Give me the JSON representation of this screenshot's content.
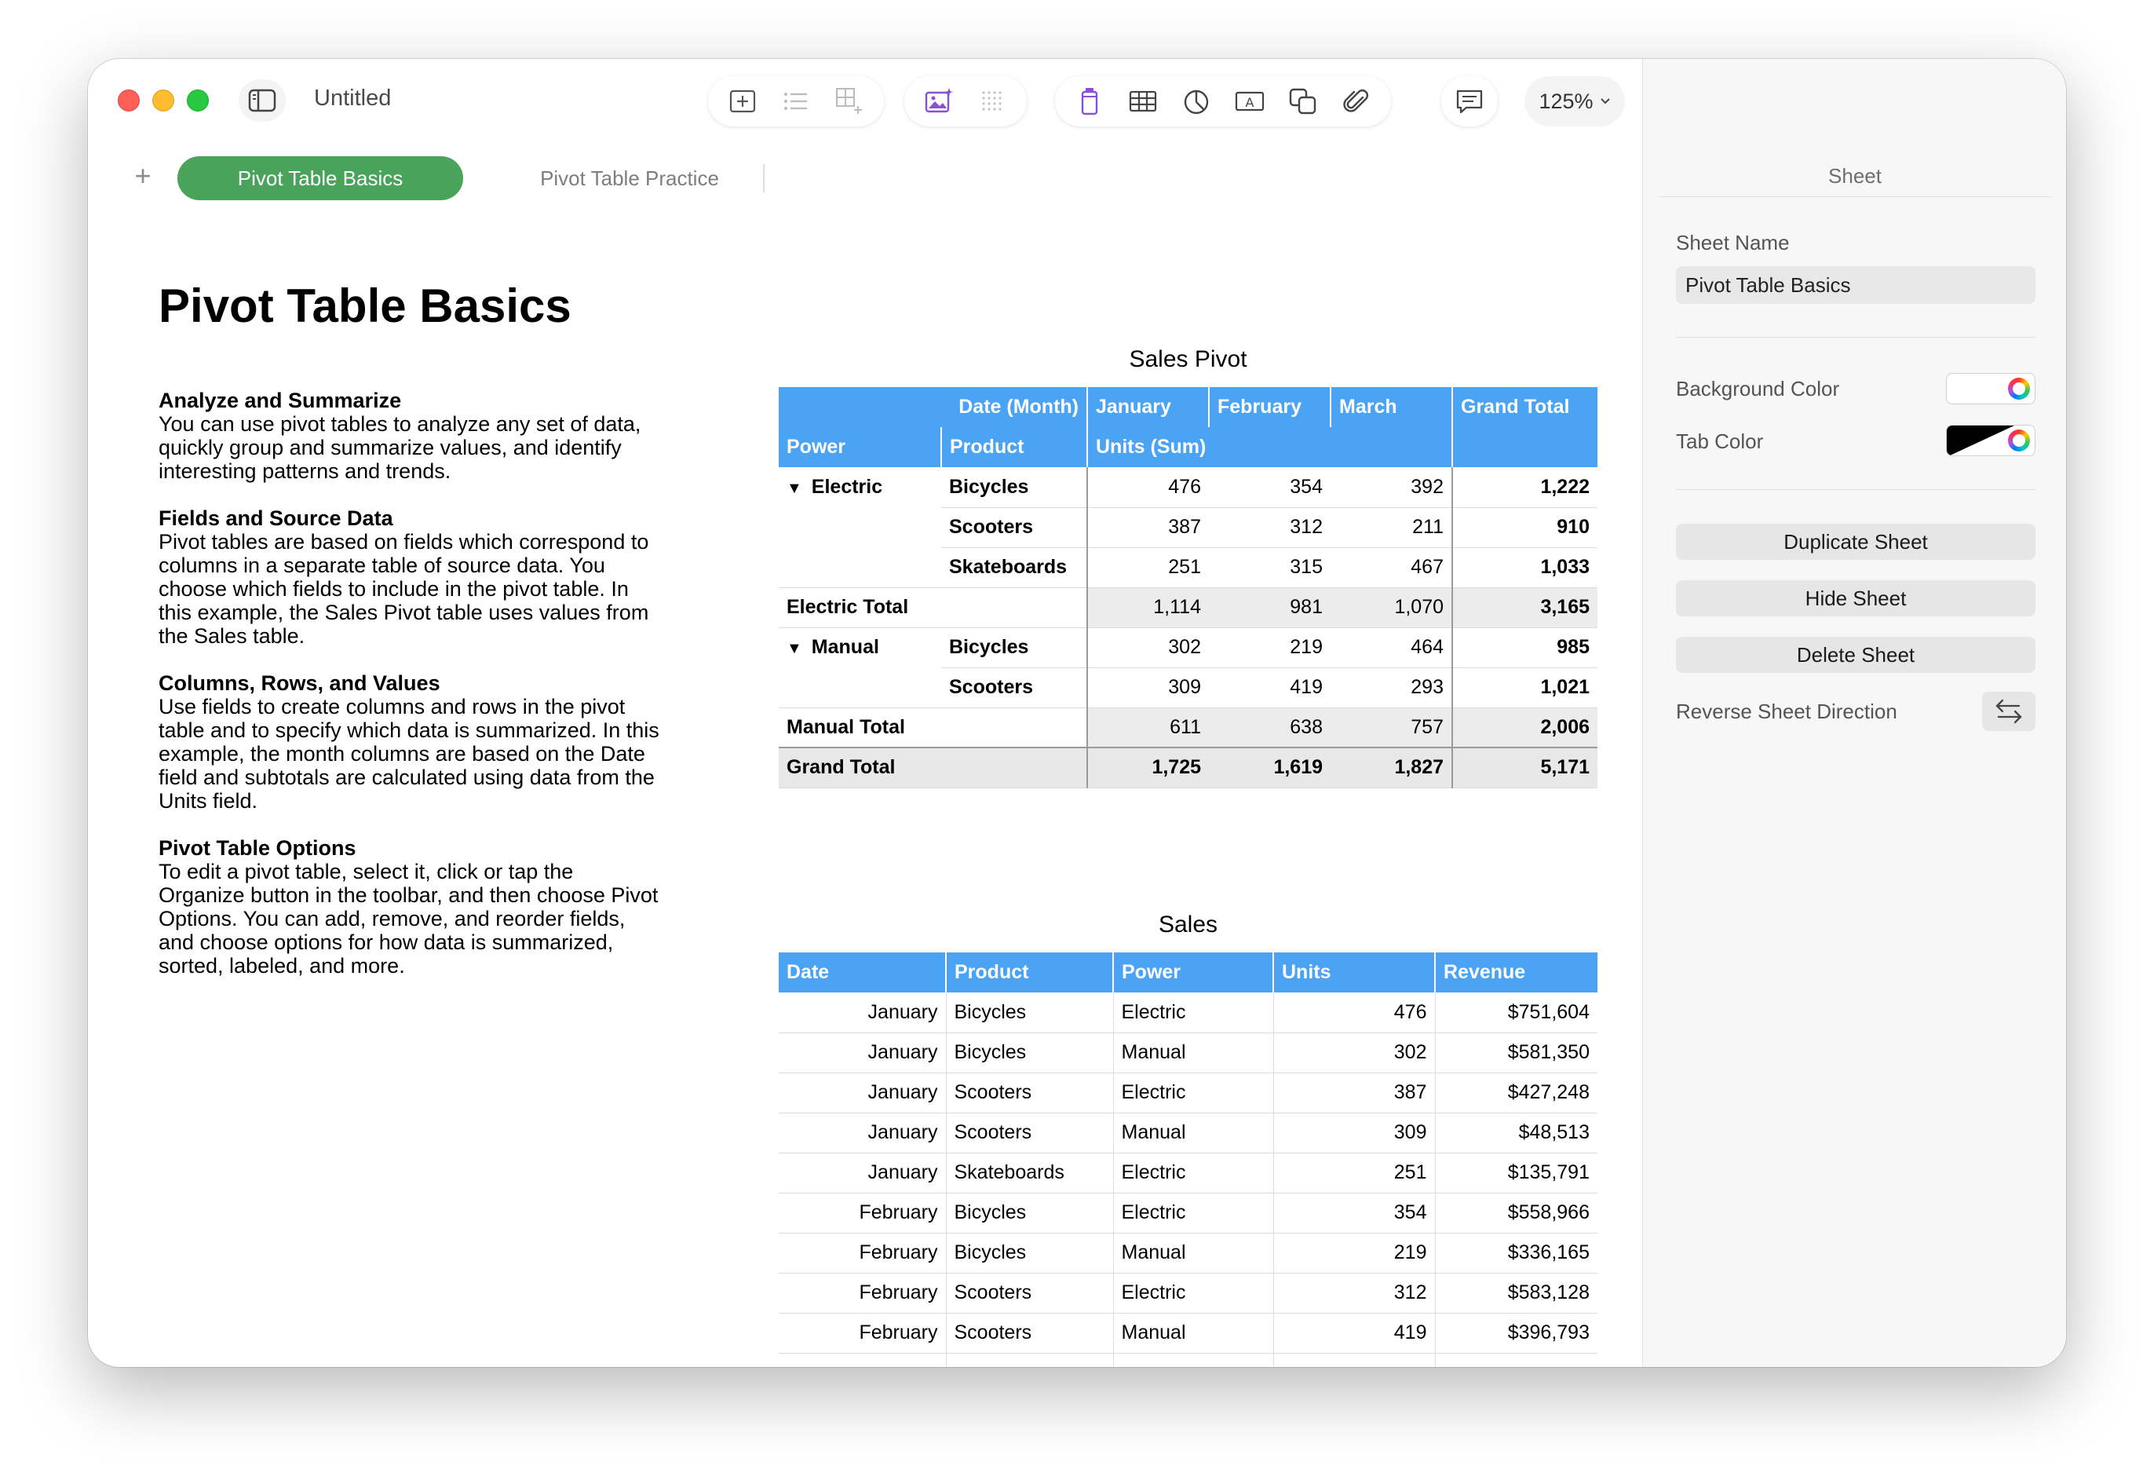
{
  "window": {
    "doc_title": "Untitled",
    "zoom": "125%"
  },
  "tabs": {
    "add": "+",
    "items": [
      {
        "label": "Pivot Table Basics",
        "active": true
      },
      {
        "label": "Pivot Table Practice",
        "active": false
      }
    ]
  },
  "canvas": {
    "title": "Pivot Table Basics",
    "sections": [
      {
        "heading": "Analyze and Summarize",
        "lines": [
          "You can use pivot tables to analyze any set of data,",
          "quickly group and summarize values, and identify",
          "interesting patterns and trends."
        ]
      },
      {
        "heading": "Fields and Source Data",
        "lines": [
          "Pivot tables are based on fields which correspond to",
          "columns in a separate table of source data. You",
          "choose which fields to include in the pivot table. In",
          "this example, the Sales Pivot table uses values from",
          "the Sales table."
        ]
      },
      {
        "heading": "Columns, Rows, and Values",
        "lines": [
          "Use fields to create columns and rows in the pivot",
          "table and to specify which data is summarized. In this",
          "example, the month columns are based on the Date",
          "field and subtotals are calculated using data from the",
          "Units field."
        ]
      },
      {
        "heading": "Pivot Table Options",
        "lines": [
          "To edit a pivot table, select it, click or tap the",
          "Organize button in the toolbar, and then choose Pivot",
          "Options. You can add, remove, and reorder fields,",
          "and choose options for how data is summarized,",
          "sorted, labeled, and more."
        ]
      }
    ]
  },
  "pivot": {
    "title": "Sales Pivot",
    "header1": {
      "date_field": "Date (Month)",
      "months": [
        "January",
        "February",
        "March"
      ],
      "grand": "Grand Total"
    },
    "header2": {
      "power": "Power",
      "product": "Product",
      "values": "Units (Sum)"
    },
    "groups": [
      {
        "name": "Electric",
        "toggle": "▼",
        "rows": [
          {
            "product": "Bicycles",
            "values": [
              "476",
              "354",
              "392"
            ],
            "total": "1,222"
          },
          {
            "product": "Scooters",
            "values": [
              "387",
              "312",
              "211"
            ],
            "total": "910"
          },
          {
            "product": "Skateboards",
            "values": [
              "251",
              "315",
              "467"
            ],
            "total": "1,033"
          }
        ],
        "subtotal": {
          "label": "Electric Total",
          "values": [
            "1,114",
            "981",
            "1,070"
          ],
          "total": "3,165"
        }
      },
      {
        "name": "Manual",
        "toggle": "▼",
        "rows": [
          {
            "product": "Bicycles",
            "values": [
              "302",
              "219",
              "464"
            ],
            "total": "985"
          },
          {
            "product": "Scooters",
            "values": [
              "309",
              "419",
              "293"
            ],
            "total": "1,021"
          }
        ],
        "subtotal": {
          "label": "Manual Total",
          "values": [
            "611",
            "638",
            "757"
          ],
          "total": "2,006"
        }
      }
    ],
    "grand_total": {
      "label": "Grand Total",
      "values": [
        "1,725",
        "1,619",
        "1,827"
      ],
      "total": "5,171"
    }
  },
  "sales": {
    "title": "Sales",
    "columns": [
      "Date",
      "Product",
      "Power",
      "Units",
      "Revenue"
    ],
    "rows": [
      [
        "January",
        "Bicycles",
        "Electric",
        "476",
        "$751,604"
      ],
      [
        "January",
        "Bicycles",
        "Manual",
        "302",
        "$581,350"
      ],
      [
        "January",
        "Scooters",
        "Electric",
        "387",
        "$427,248"
      ],
      [
        "January",
        "Scooters",
        "Manual",
        "309",
        "$48,513"
      ],
      [
        "January",
        "Skateboards",
        "Electric",
        "251",
        "$135,791"
      ],
      [
        "February",
        "Bicycles",
        "Electric",
        "354",
        "$558,966"
      ],
      [
        "February",
        "Bicycles",
        "Manual",
        "219",
        "$336,165"
      ],
      [
        "February",
        "Scooters",
        "Electric",
        "312",
        "$583,128"
      ],
      [
        "February",
        "Scooters",
        "Manual",
        "419",
        "$396,793"
      ]
    ]
  },
  "inspector": {
    "header": "Sheet",
    "sheet_name_label": "Sheet Name",
    "sheet_name_value": "Pivot Table Basics",
    "background_color_label": "Background Color",
    "tab_color_label": "Tab Color",
    "duplicate": "Duplicate Sheet",
    "hide": "Hide Sheet",
    "delete": "Delete Sheet",
    "reverse": "Reverse Sheet Direction"
  },
  "colors": {
    "active_tab": "#49a35a",
    "table_header": "#4aa3f3",
    "close": "#fe5f57",
    "minimize": "#febc2e",
    "zoom": "#28c840"
  },
  "icons": [
    "sidebar-icon",
    "insert-table-icon",
    "list-icon",
    "grid-add-icon",
    "image-playground-icon",
    "dot-grid-icon",
    "chart-glass-icon",
    "table-icon",
    "pie-chart-icon",
    "text-box-icon",
    "shapes-icon",
    "paperclip-icon",
    "comment-icon",
    "chevron-down-icon",
    "share-icon",
    "format-brush-icon",
    "organize-icon",
    "reverse-direction-icon"
  ]
}
